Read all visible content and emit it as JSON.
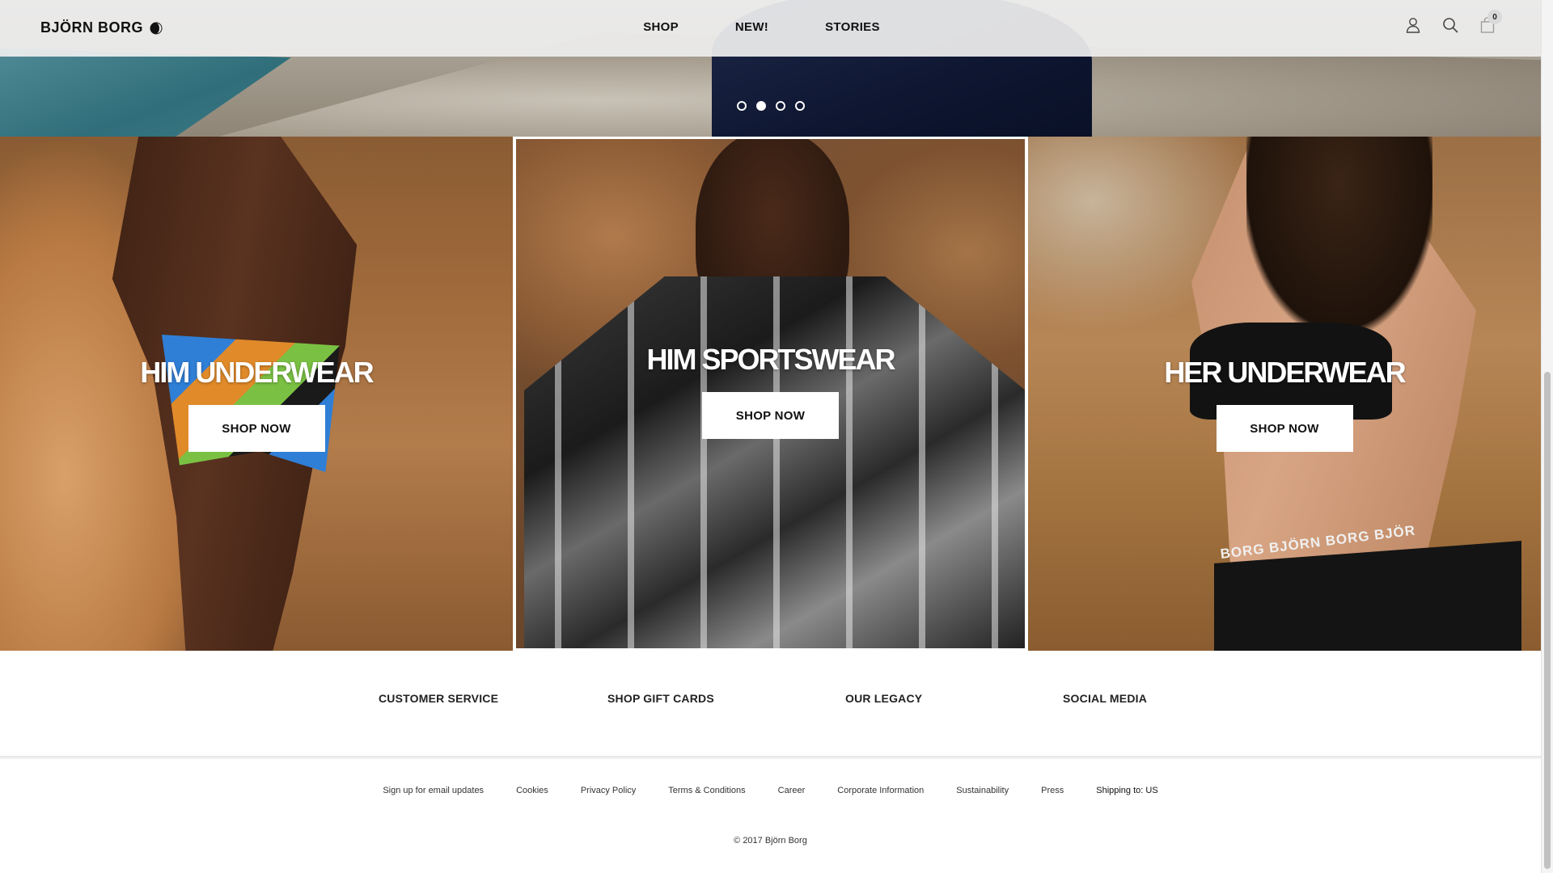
{
  "brand": {
    "name": "BJÖRN BORG"
  },
  "nav": {
    "items": [
      "SHOP",
      "NEW!",
      "STORIES"
    ]
  },
  "header_icons": {
    "account": "user-icon",
    "search": "search-icon",
    "cart": "shopping-bag-icon",
    "cart_count": "0"
  },
  "hero": {
    "slide_count": 4,
    "active_slide": 2
  },
  "tiles": [
    {
      "title": "HIM UNDERWEAR",
      "button": "SHOP NOW"
    },
    {
      "title": "HIM SPORTSWEAR",
      "button": "SHOP NOW"
    },
    {
      "title": "HER UNDERWEAR",
      "button": "SHOP NOW",
      "waistband_text": "BORG BJÖRN BORG BJÖR"
    }
  ],
  "footer": {
    "categories": [
      "CUSTOMER SERVICE",
      "SHOP GIFT CARDS",
      "OUR LEGACY",
      "SOCIAL MEDIA"
    ],
    "links": [
      "Sign up for email updates",
      "Cookies",
      "Privacy Policy",
      "Terms & Conditions",
      "Career",
      "Corporate Information",
      "Sustainability",
      "Press"
    ],
    "shipping": "Shipping to: US",
    "copyright": "© 2017 Björn Borg"
  },
  "colors": {
    "header_bg": "#eeeeee",
    "text": "#111111",
    "button_bg": "#ffffff"
  }
}
